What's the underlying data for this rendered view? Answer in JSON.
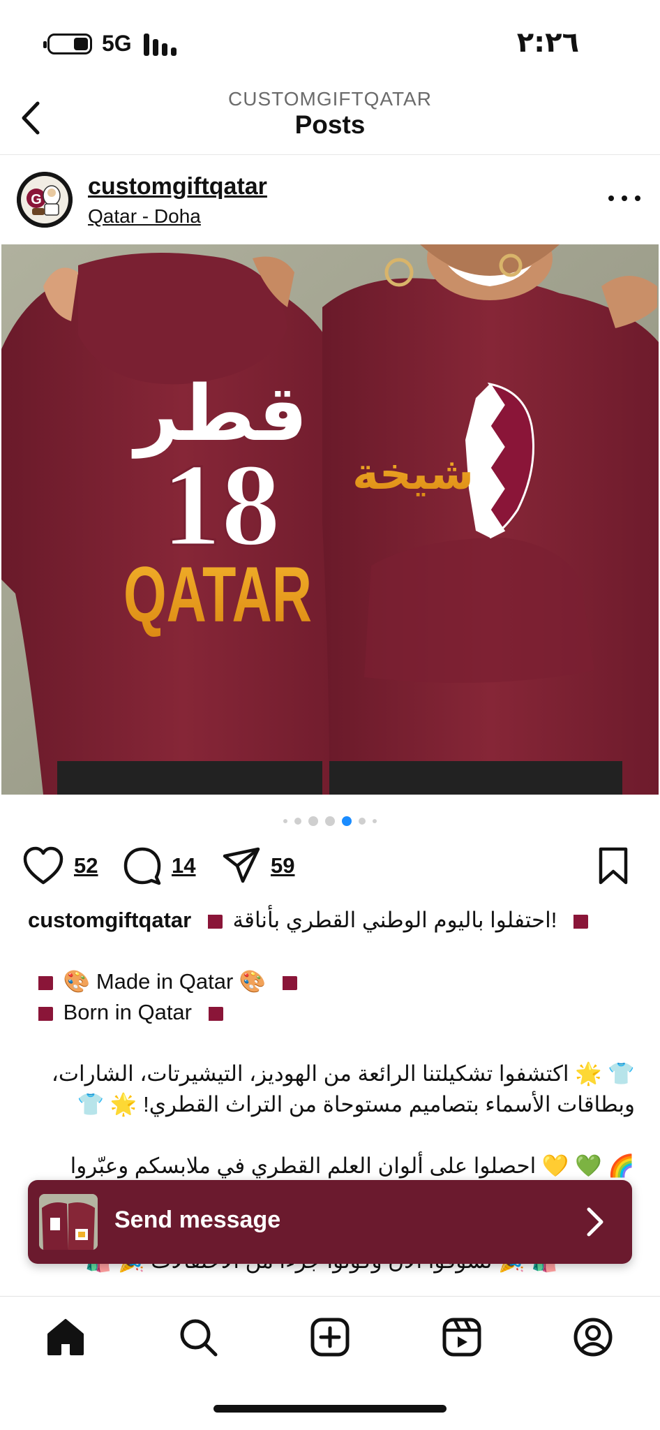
{
  "status_bar": {
    "network": "5G",
    "time": "٢:٢٦",
    "battery_icon": "battery-icon",
    "signal_icon": "signal-bars-icon"
  },
  "header": {
    "account": "CUSTOMGIFTQATAR",
    "title": "Posts",
    "back_icon": "chevron-left-icon"
  },
  "post": {
    "username": "customgiftqatar",
    "location": "Qatar - Doha",
    "more_icon": "more-horizontal-icon",
    "image": {
      "left_print_arabic": "قطر",
      "left_print_number": "18",
      "left_print_word": "QATAR",
      "right_print_arabic": "شيخة"
    },
    "carousel": {
      "total": 7,
      "active_index": 4
    },
    "likes": "52",
    "comments": "14",
    "shares": "59",
    "caption": {
      "username": "customgiftqatar",
      "line1": "!احتفلوا باليوم الوطني القطري بأناقة",
      "line2": "Made in Qatar",
      "line3": "Born in Qatar",
      "line4": "اكتشفوا تشكيلتنا الرائعة من الهوديز، التيشيرتات، الشارات،",
      "line5": "وبطاقات الأسماء بتصاميم مستوحاة من التراث القطري!",
      "line6": "احصلوا على ألوان العلم القطري في ملابسكم وعبّروا",
      "line7": "تسوقوا الآن وكونوا جزءًا من الاحتفالات"
    }
  },
  "send_message": {
    "label": "Send message",
    "arrow_icon": "chevron-right-icon"
  },
  "bottom_nav": {
    "items": [
      "home-icon",
      "search-icon",
      "create-icon",
      "reels-icon",
      "profile-icon"
    ]
  },
  "colors": {
    "maroon": "#8a1538",
    "banner": "#6b1a2e",
    "active_dot": "#1a8cff",
    "gold": "#f0a623"
  }
}
